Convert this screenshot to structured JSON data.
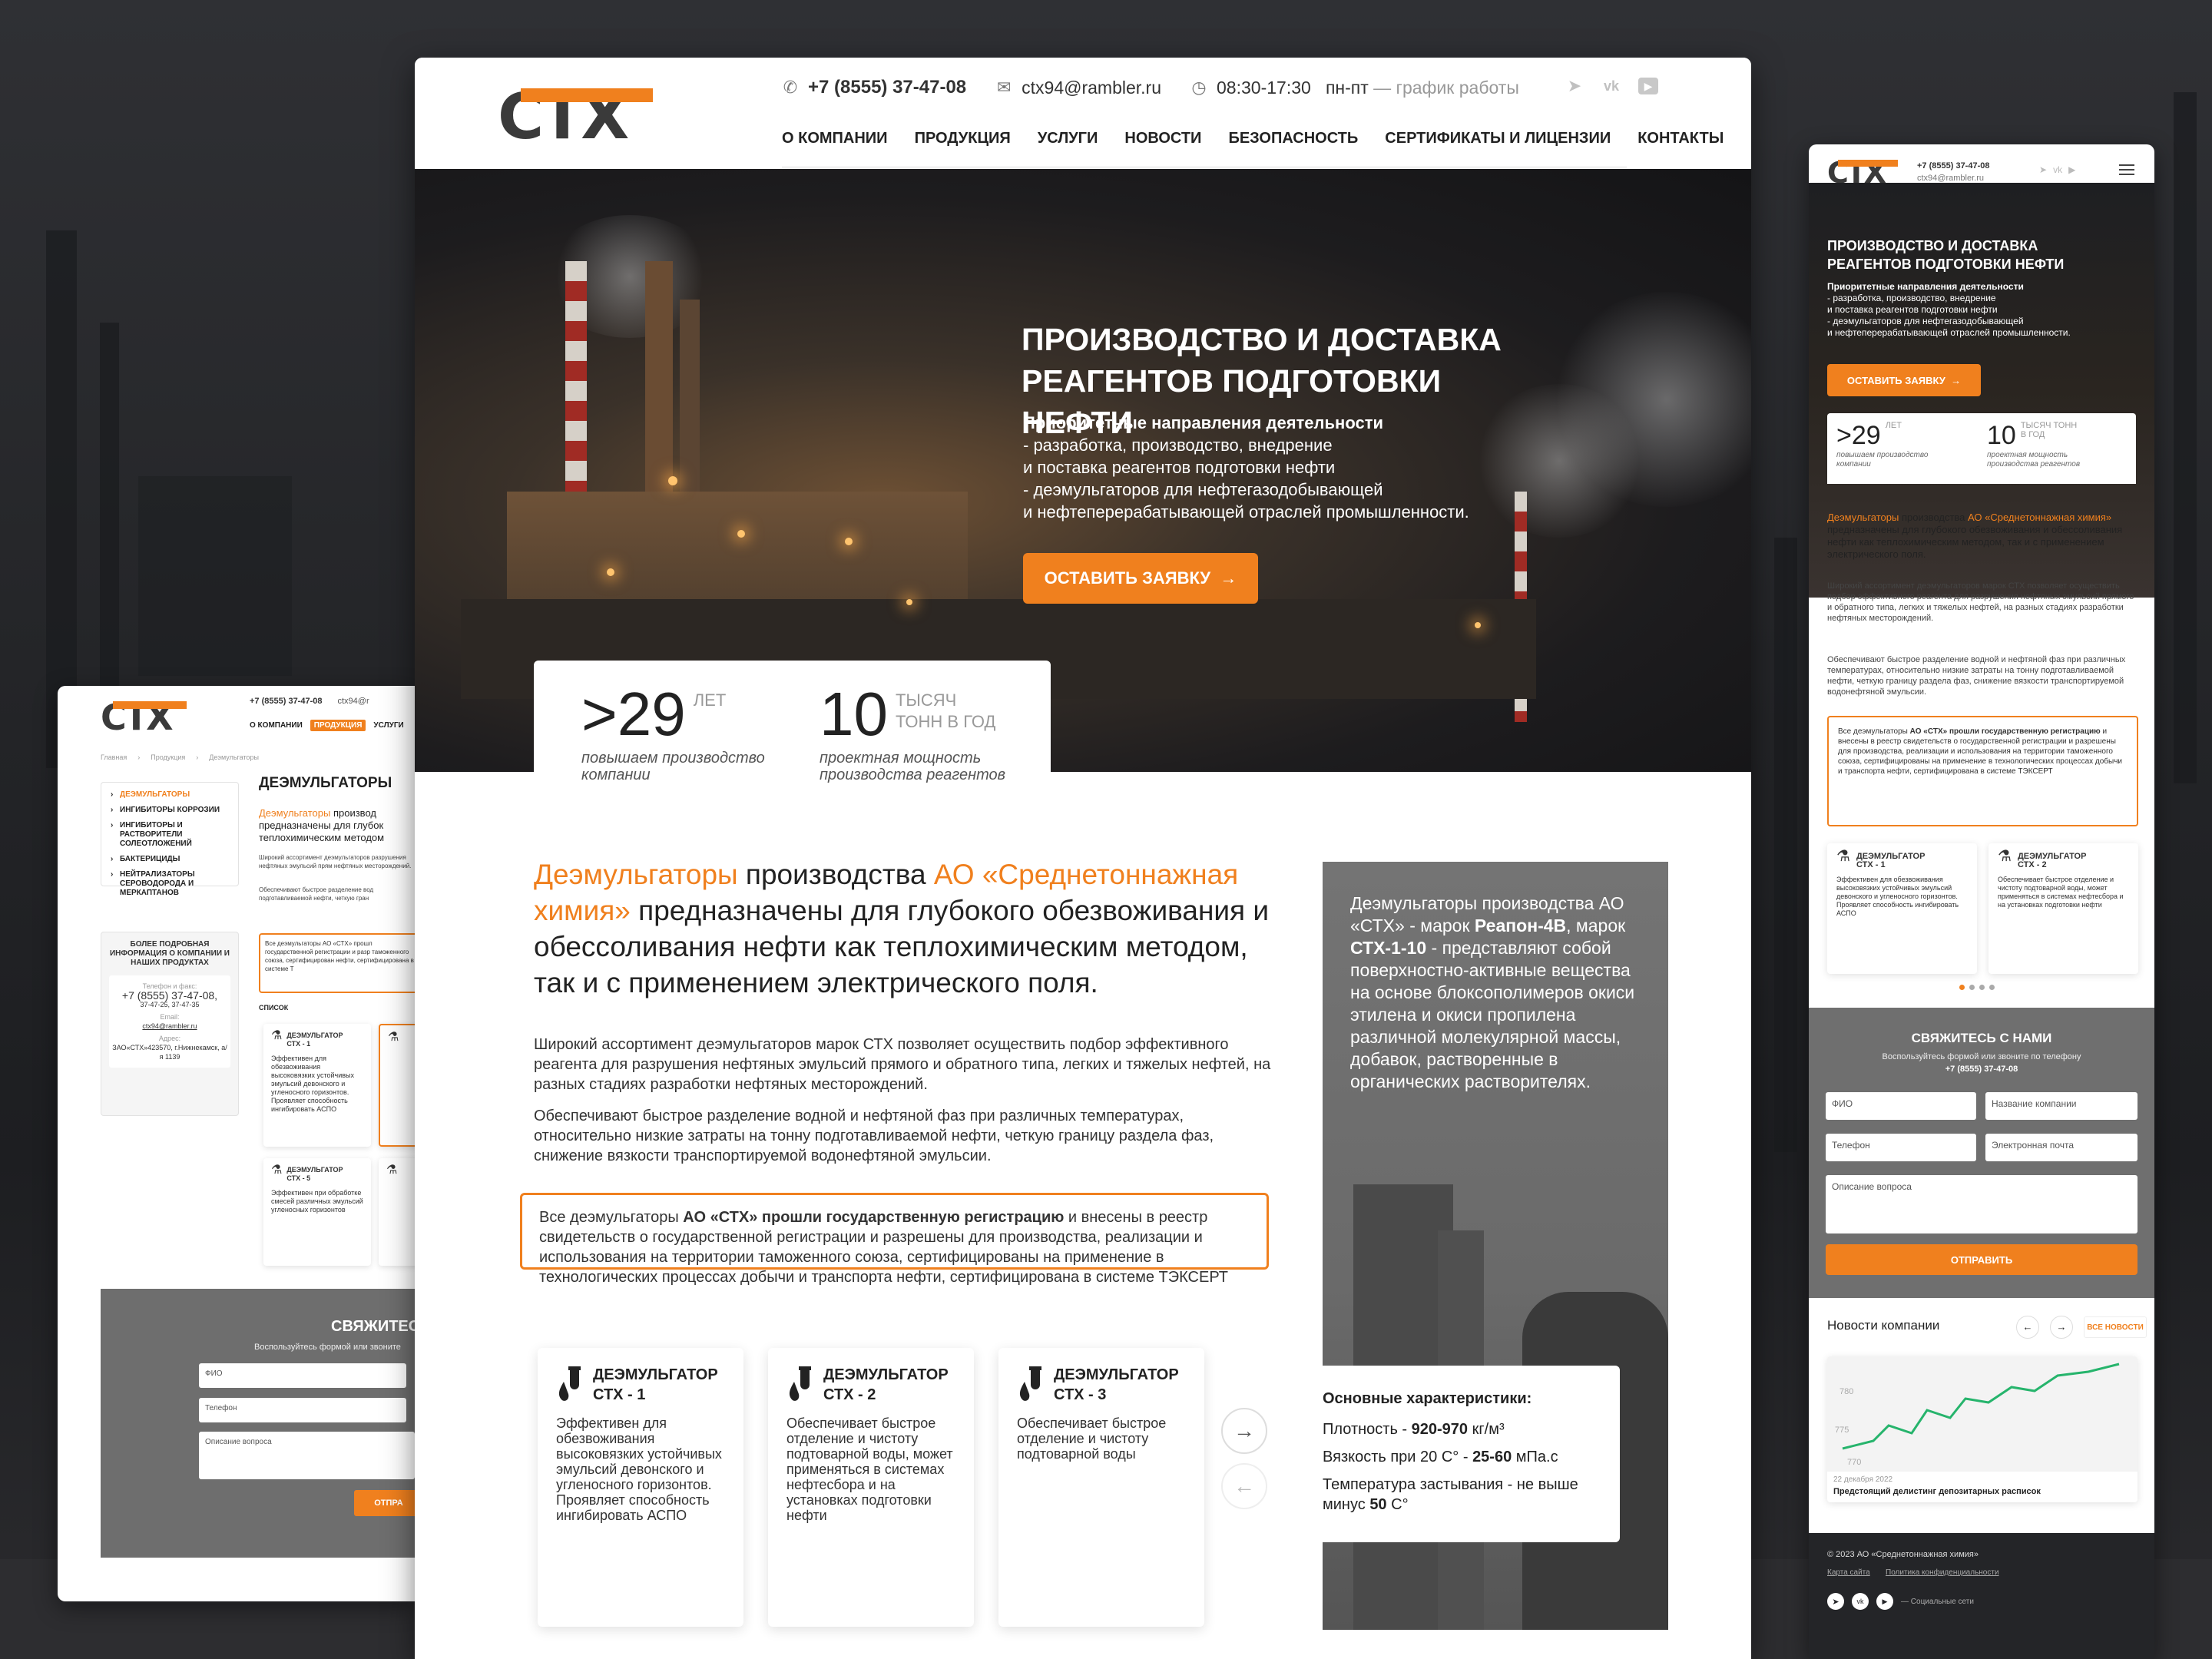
{
  "main": {
    "header": {
      "phone": "+7 (8555) 37-47-08",
      "email": "ctx94@rambler.ru",
      "hours": "08:30-17:30",
      "days": "пн-пт",
      "schedule": "— график работы",
      "logo_text": "СТХ"
    },
    "nav": [
      "О КОМПАНИИ",
      "ПРОДУКЦИЯ",
      "УСЛУГИ",
      "НОВОСТИ",
      "БЕЗОПАСНОСТЬ",
      "СЕРТИФИКАТЫ И ЛИЦЕНЗИИ",
      "КОНТАКТЫ"
    ],
    "hero": {
      "title_line1": "ПРОИЗВОДСТВО И ДОСТАВКА",
      "title_line2": "РЕАГЕНТОВ ПОДГОТОВКИ НЕФТИ",
      "priority_title": "Приоритетные направления деятельности",
      "priority_lines": [
        "- разработка, производство, внедрение",
        "и поставка реагентов подготовки нефти",
        "- деэмульгаторов для нефтегазодобывающей",
        "и нефтеперерабатывающей отраслей промышленности."
      ],
      "cta": "ОСТАВИТЬ ЗАЯВКУ"
    },
    "stats": [
      {
        "big": ">29",
        "small": "ЛЕТ",
        "small2": "",
        "caption1": "повышаем производство",
        "caption2": "компании"
      },
      {
        "big": "10",
        "small": "ТЫСЯЧ",
        "small2": "ТОНН В ГОД",
        "caption1": "проектная мощность",
        "caption2": "производства реагентов"
      }
    ],
    "intro": {
      "orange1": "Деэмульгаторы",
      "text1": " производства ",
      "orange2": "АО «Среднетоннажная химия»",
      "text2": " предназначены для глубокого обезвоживания и обессоливания нефти как теплохимическим методом, так и с применением электрического поля."
    },
    "para1": "Широкий ассортимент деэмульгаторов марок СТХ позволяет осуществить подбор эффективного реагента для разрушения нефтяных эмульсий прямого и обратного типа, легких и тяжелых нефтей, на разных стадиях разработки нефтяных месторождений.",
    "para2": "Обеспечивают быстрое разделение водной и нефтяной фаз при различных температурах, относительно низкие затраты на тонну подготавливаемой нефти, четкую границу раздела фаз, снижение вязкости транспортируемой водонефтяной эмульсии.",
    "notice": {
      "pre": "Все деэмульгаторы ",
      "bold": "АО «СТХ» прошли государственную регистрацию",
      "post": " и внесены в реестр свидетельств о государственной регистрации и разрешены для производства, реализации и использования на территории таможенного союза, сертифицированы на применение в технологических процессах добычи и транспорта нефти, сертифицирована в системе ТЭКСЕРТ"
    },
    "cards": [
      {
        "t1": "ДЕЭМУЛЬГАТОР",
        "t2": "СТХ - 1",
        "text": "Эффективен для обезвоживания высоковязких устойчивых эмульсий девонского и угленосного горизонтов. Проявляет способность ингибировать АСПО"
      },
      {
        "t1": "ДЕЭМУЛЬГАТОР",
        "t2": "СТХ - 2",
        "text": "Обеспечивает быстрое отделение и чистоту подтоварной воды, может применяться в системах нефтесбора и на установках подготовки нефти"
      },
      {
        "t1": "ДЕЭМУЛЬГАТОР",
        "t2": "СТХ - 3",
        "text": "Обеспечивает быстрое отделение и чистоту подтоварной воды"
      }
    ],
    "grey": {
      "t1": "Деэмульгаторы производства АО «СТХ» - марок ",
      "b1": "Реапон-4В",
      "t2": ", марок ",
      "b2": "СТХ-1-10",
      "t3": " - представляют собой поверхностно-активные вещества на основе блоксополимеров окиси этилена и окиси пропилена различной молекулярной массы, добавок, растворенные в органических растворителях."
    },
    "specs": {
      "title": "Основные характеристики:",
      "l1a": "Плотность - ",
      "l1b": "920-970",
      "l1c": " кг/м³",
      "l2a": "Вязкость при 20 С° - ",
      "l2b": "25-60",
      "l2c": " мПа.с",
      "l3a": "Температура застывания - не выше минус ",
      "l3b": "50",
      "l3c": " С°"
    }
  },
  "left": {
    "phone": "+7 (8555) 37-47-08",
    "email_short": "ctx94@r",
    "nav": [
      "О КОМПАНИИ",
      "ПРОДУКЦИЯ",
      "УСЛУГИ"
    ],
    "breadcrumb": [
      "Главная",
      "Продукция",
      "Деэмульгаторы"
    ],
    "side": [
      "ДЕЭМУЛЬГАТОРЫ",
      "ИНГИБИТОРЫ КОРРОЗИИ",
      "ИНГИБИТОРЫ И РАСТВОРИТЕЛИ СОЛЕОТЛОЖЕНИЙ",
      "БАКТЕРИЦИДЫ",
      "НЕЙТРАЛИЗАТОРЫ СЕРОВОДОРОДА И МЕРКАПТАНОВ"
    ],
    "title": "ДЕЭМУЛЬГАТОРЫ",
    "intro_orange": "Деэмульгаторы",
    "intro_rest": " производ предназначены для глубок теплохимическим методом",
    "p1": "Широкий ассортимент деэмульгаторов разрушения нефтяных эмульсий прям нефтяных месторождений.",
    "p2": "Обеспечивают быстрое разделение вод подготавливаемой нефти, четкую гран",
    "notice": "Все деэмульгаторы АО «СТХ» прошл государственной регистрации и разр таможенного союза, сертифицирован нефти, сертифицирована в системе Т",
    "list_label": "СПИСОК",
    "info_title": "БОЛЕЕ ПОДРОБНАЯ ИНФОРМАЦИЯ О КОМПАНИИ И НАШИХ ПРОДУКТАХ",
    "info_phone_label": "Телефон и факс:",
    "info_phone": "+7 (8555) 37-47-08,",
    "info_phone2": "37-47-25, 37-47-35",
    "info_email_label": "Email:",
    "info_email": "ctx94@rambler.ru",
    "info_addr_label": "Адрес:",
    "info_addr": "ЗАО«СТХ»423570, г.Нижнекамск, а/я 1139",
    "cards": [
      {
        "t1": "ДЕЭМУЛЬГАТОР",
        "t2": "СТХ - 1",
        "text": "Эффективен для обезвоживания высоковязких устойчивых эмульсий девонского и угленосного горизонтов. Проявляет способность ингибировать АСПО"
      },
      {
        "t1": "ДЕЭМУЛЬГАТОР",
        "t2": "СТХ - 5",
        "text": "Эффективен при обработке смесей различных эмульсий угленосных горизонтов"
      }
    ],
    "form_title": "СВЯЖИТЕС",
    "form_sub": "Воспользуйтесь формой или звоните",
    "f_fio": "ФИО",
    "f_phone": "Телефон",
    "f_q": "Описание вопроса",
    "f_btn": "ОТПРА"
  },
  "right": {
    "phone": "+7 (8555) 37-47-08",
    "email": "ctx94@rambler.ru",
    "title1": "ПРОИЗВОДСТВО И ДОСТАВКА",
    "title2": "РЕАГЕНТОВ ПОДГОТОВКИ НЕФТИ",
    "prio": "Приоритетные направления деятельности",
    "prio_lines": [
      "- разработка, производство, внедрение",
      "и поставка реагентов подготовки нефти",
      "- деэмульгаторов для нефтегазодобывающей",
      "и нефтеперерабатывающей отраслей промышленности."
    ],
    "cta": "ОСТАВИТЬ ЗАЯВКУ",
    "s1_big": ">29",
    "s1_sm": "ЛЕТ",
    "s1_cap": "повышаем производство компании",
    "s2_big": "10",
    "s2_sm": "ТЫСЯЧ ТОНН В ГОД",
    "s2_cap": "проектная мощность производства реагентов",
    "intro_o1": "Деэмульгаторы",
    "intro_t1": " производства ",
    "intro_o2": "АО «Среднетоннажная химия»",
    "intro_t2": " предназначены для глубокого обезвоживания и обессоливания нефти как теплохимическим методом, так и с применением электрического поля.",
    "p1": "Широкий ассортимент деэмульгаторов марок СТХ позволяет осуществить подбор эффективного реагента для разрушения нефтяных эмульсий прямого и обратного типа, легких и тяжелых нефтей, на разных стадиях разработки нефтяных месторождений.",
    "p2": "Обеспечивают быстрое разделение водной и нефтяной фаз при различных температурах, относительно низкие затраты на тонну подготавливаемой нефти, четкую границу раздела фаз, снижение вязкости транспортируемой водонефтяной эмульсии.",
    "notice_pre": "Все деэмульгаторы ",
    "notice_bold": "АО «СТХ» прошли государственную регистрацию",
    "notice_post": " и внесены в реестр свидетельств о государственной регистрации и разрешены для производства, реализации и использования на территории таможенного союза, сертифицированы на применение в технологических процессах добычи и транспорта нефти, сертифицирована в системе ТЭКСЕРТ",
    "cards": [
      {
        "t1": "ДЕЭМУЛЬГАТОР",
        "t2": "СТХ - 1",
        "text": "Эффективен для обезвоживания высоковязких устойчивых эмульсий девонского и угленосного горизонтов. Проявляет способность ингибировать АСПО"
      },
      {
        "t1": "ДЕЭМУЛЬГАТОР",
        "t2": "СТХ - 2",
        "text": "Обеспечивает быстрое отделение и чистоту подтоварной воды, может применяться в системах нефтесбора и на установках подготовки нефти"
      }
    ],
    "form_title": "СВЯЖИТЕСЬ С НАМИ",
    "form_sub": "Воспользуйтесь формой или звоните по телефону",
    "form_phone": "+7 (8555) 37-47-08",
    "f_fio": "ФИО",
    "f_company": "Название компании",
    "f_phone": "Телефон",
    "f_email": "Электронная почта",
    "f_q": "Описание вопроса",
    "f_btn": "ОТПРАВИТЬ",
    "news_title": "Новости компании",
    "news_all": "ВСЕ НОВОСТИ",
    "chart_ticks": [
      "780",
      "775",
      "770"
    ],
    "news_date": "22 декабря 2022",
    "news_head": "Предстоящий делистинг депозитарных расписок",
    "copyright": "© 2023 АО «Среднетоннажная химия»",
    "link1": "Карта сайта",
    "link2": "Политика конфиденциальности",
    "soc_label": "Социальные сети"
  }
}
